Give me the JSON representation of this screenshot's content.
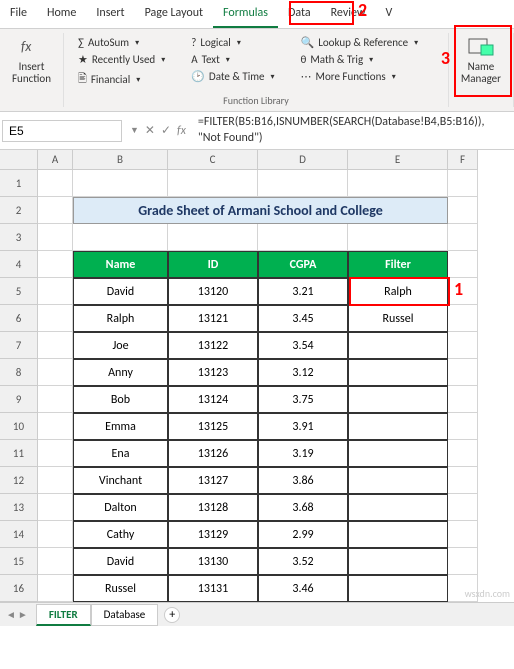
{
  "ribbon_tabs": [
    "File",
    "Home",
    "Insert",
    "Page Layout",
    "Formulas",
    "Data",
    "Review",
    "V"
  ],
  "active_tab_index": 4,
  "ribbon": {
    "insert_function": "Insert\nFunction",
    "autosum": "AutoSum",
    "recently_used": "Recently Used",
    "financial": "Financial",
    "logical": "Logical",
    "text": "Text",
    "date_time": "Date & Time",
    "lookup_ref": "Lookup & Reference",
    "math_trig": "Math & Trig",
    "more_functions": "More Functions",
    "name_manager": "Name\nManager",
    "group_label": "Function Library"
  },
  "name_box": "E5",
  "formula": "=FILTER(B5:B16,ISNUMBER(SEARCH(Database!B4,B5:B16)), \"Not Found\")",
  "columns": {
    "A": 35,
    "B": 95,
    "C": 90,
    "D": 90,
    "E": 100,
    "F": 30
  },
  "sheet_title": "Grade Sheet of Armani School and College",
  "headers": [
    "Name",
    "ID",
    "CGPA",
    "Filter"
  ],
  "rows": [
    {
      "name": "David",
      "id": "13120",
      "cgpa": "3.21",
      "filter": "Ralph"
    },
    {
      "name": "Ralph",
      "id": "13121",
      "cgpa": "3.45",
      "filter": "Russel"
    },
    {
      "name": "Joe",
      "id": "13122",
      "cgpa": "3.54",
      "filter": ""
    },
    {
      "name": "Anny",
      "id": "13123",
      "cgpa": "3.12",
      "filter": ""
    },
    {
      "name": "Bob",
      "id": "13124",
      "cgpa": "3.75",
      "filter": ""
    },
    {
      "name": "Emma",
      "id": "13125",
      "cgpa": "3.91",
      "filter": ""
    },
    {
      "name": "Ena",
      "id": "13126",
      "cgpa": "3.19",
      "filter": ""
    },
    {
      "name": "Vinchant",
      "id": "13127",
      "cgpa": "3.86",
      "filter": ""
    },
    {
      "name": "Dalton",
      "id": "13128",
      "cgpa": "3.68",
      "filter": ""
    },
    {
      "name": "Cathy",
      "id": "13129",
      "cgpa": "2.99",
      "filter": ""
    },
    {
      "name": "David",
      "id": "13130",
      "cgpa": "3.52",
      "filter": ""
    },
    {
      "name": "Russel",
      "id": "13131",
      "cgpa": "3.46",
      "filter": ""
    }
  ],
  "sheet_tabs": [
    "FILTER",
    "Database"
  ],
  "active_sheet_index": 0,
  "annotations": {
    "a1": "1",
    "a2": "2",
    "a3": "3"
  },
  "watermark": "wsxdn.com"
}
